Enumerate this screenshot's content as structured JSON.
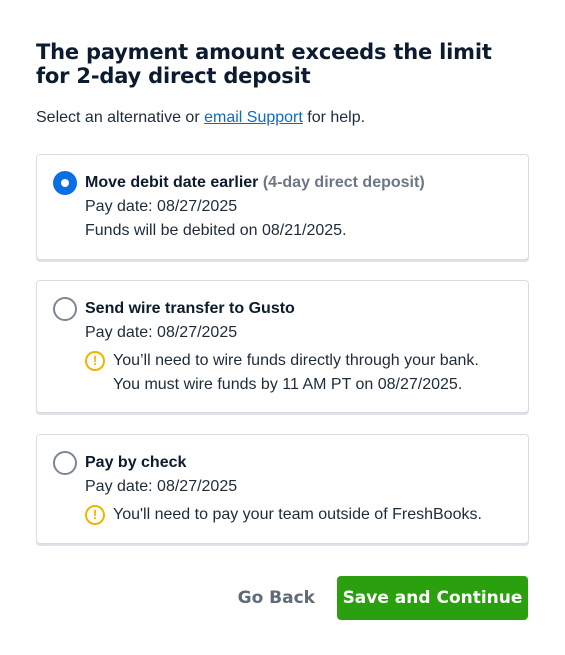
{
  "dialog": {
    "title": "The payment amount exceeds the limit for 2-day direct deposit",
    "subtitle_before": "Select an alternative or ",
    "subtitle_link": "email Support",
    "subtitle_after": " for help."
  },
  "options": [
    {
      "title": "Move debit date earlier",
      "title_note": "(4-day direct deposit)",
      "pay_date": "Pay date: 08/27/2025",
      "detail": "Funds will be debited on 08/21/2025.",
      "selected": true
    },
    {
      "title": "Send wire transfer to Gusto",
      "pay_date": "Pay date: 08/27/2025",
      "warning_1": "You’ll need to wire funds directly through your bank.",
      "warning_2": "You must wire funds by 11 AM PT on 08/27/2025.",
      "selected": false
    },
    {
      "title": "Pay by check",
      "pay_date": "Pay date: 08/27/2025",
      "warning_1": "You'll need to pay your team outside of FreshBooks.",
      "selected": false
    }
  ],
  "footer": {
    "back_label": "Go Back",
    "continue_label": "Save and Continue"
  },
  "icons": {
    "warning": "!"
  },
  "colors": {
    "primary_button": "#2aa00f",
    "radio_selected": "#0a6ee5",
    "link": "#0f6cbd",
    "warning": "#f0b400"
  }
}
